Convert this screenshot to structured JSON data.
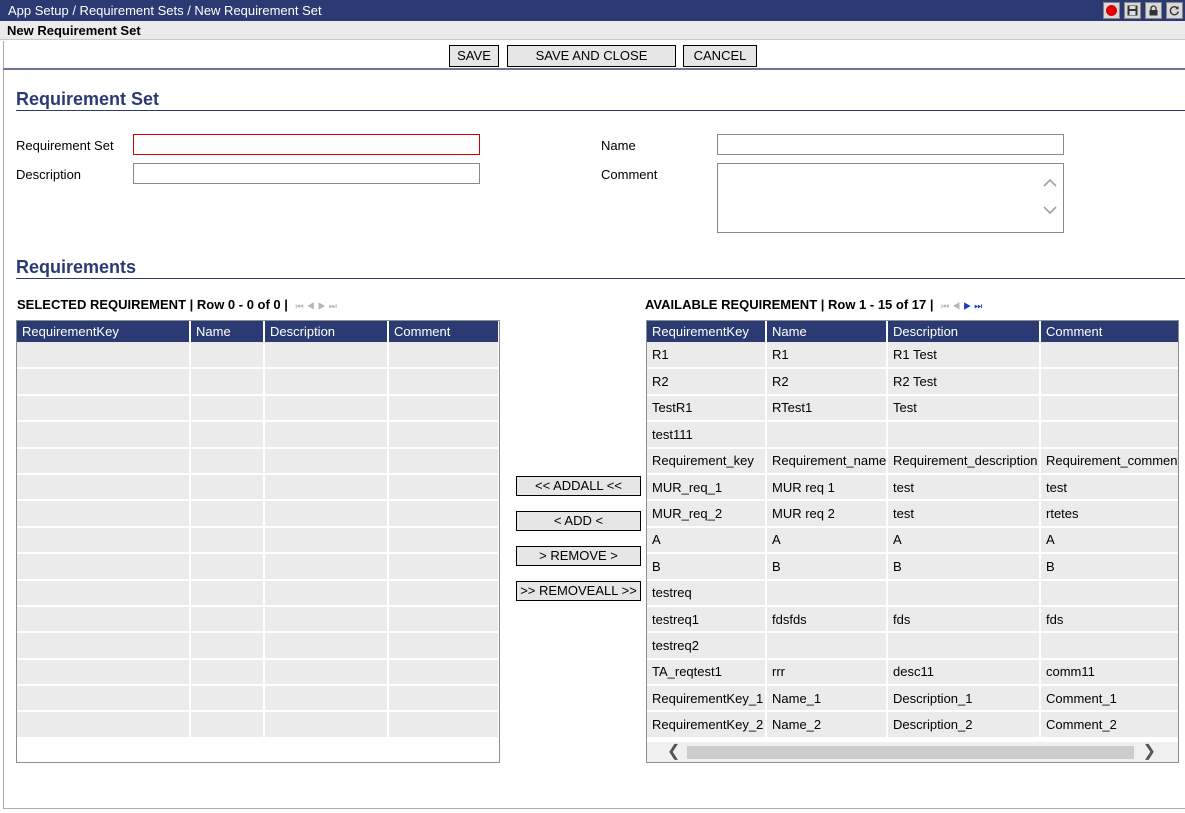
{
  "titlebar": {
    "breadcrumb": "App Setup / Requirement Sets / New Requirement Set",
    "icons": [
      "record-icon",
      "save-disk-icon",
      "lock-icon",
      "refresh-icon"
    ]
  },
  "page_title": "New Requirement Set",
  "toolbar": {
    "save": "SAVE",
    "save_and_close": "SAVE AND CLOSE",
    "cancel": "CANCEL"
  },
  "requirement_set_section": {
    "title": "Requirement Set",
    "fields": {
      "requirement_set_label": "Requirement Set",
      "requirement_set_value": "",
      "description_label": "Description",
      "description_value": "",
      "name_label": "Name",
      "name_value": "",
      "comment_label": "Comment",
      "comment_value": ""
    }
  },
  "requirements_section": {
    "title": "Requirements"
  },
  "selected": {
    "caption": "SELECTED REQUIREMENT | Row 0 - 0 of 0 |",
    "columns": [
      "RequirementKey",
      "Name",
      "Description",
      "Comment"
    ],
    "empty_rows": 15
  },
  "available": {
    "caption": "AVAILABLE REQUIREMENT | Row 1 - 15 of 17 |",
    "columns": [
      "RequirementKey",
      "Name",
      "Description",
      "Comment"
    ],
    "rows": [
      [
        "R1",
        "R1",
        "R1 Test",
        ""
      ],
      [
        "R2",
        "R2",
        "R2 Test",
        ""
      ],
      [
        "TestR1",
        "RTest1",
        "Test",
        ""
      ],
      [
        "test111",
        "",
        "",
        ""
      ],
      [
        "Requirement_key",
        "Requirement_name",
        "Requirement_description",
        "Requirement_comment"
      ],
      [
        "MUR_req_1",
        "MUR req 1",
        "test",
        "test"
      ],
      [
        "MUR_req_2",
        "MUR req 2",
        "test",
        "rtetes"
      ],
      [
        "A",
        "A",
        "A",
        "A"
      ],
      [
        "B",
        "B",
        "B",
        "B"
      ],
      [
        "testreq",
        "",
        "",
        ""
      ],
      [
        "testreq1",
        "fdsfds",
        "fds",
        "fds"
      ],
      [
        "testreq2",
        "",
        "",
        ""
      ],
      [
        "TA_reqtest1",
        "rrr",
        "desc11",
        "comm11"
      ],
      [
        "RequirementKey_1",
        "Name_1",
        "Description_1",
        "Comment_1"
      ],
      [
        "RequirementKey_2",
        "Name_2",
        "Description_2",
        "Comment_2"
      ]
    ]
  },
  "transfer_buttons": {
    "add_all": "<< ADDALL <<",
    "add": "< ADD <",
    "remove": "> REMOVE >",
    "remove_all": ">> REMOVEALL >>"
  }
}
